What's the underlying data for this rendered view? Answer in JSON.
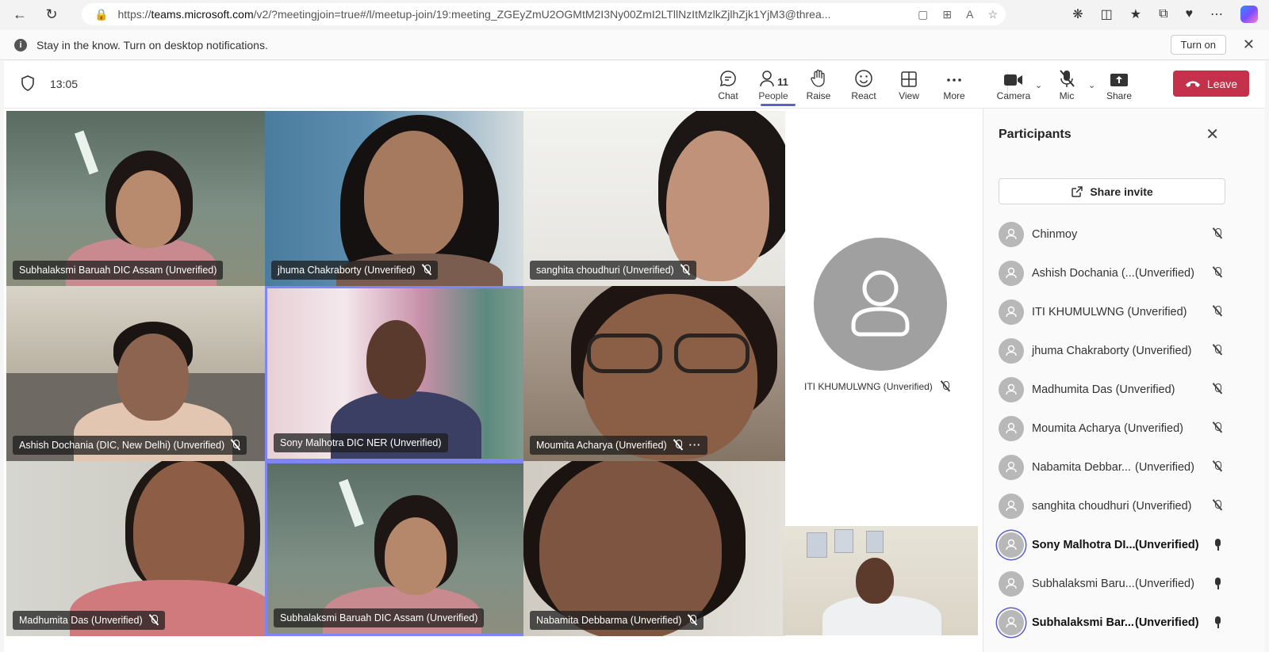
{
  "browser": {
    "url_prefix": "https://",
    "url_host": "teams.microsoft.com",
    "url_rest": "/v2/?meetingjoin=true#/l/meetup-join/19:meeting_ZGEyZmU2OGMtM2I3Ny00ZmI2LTllNzItMzlkZjlhZjk1YjM3@threa..."
  },
  "notification": {
    "text": "Stay in the know. Turn on desktop notifications.",
    "turn_on_label": "Turn on"
  },
  "meeting": {
    "time": "13:05",
    "tools": {
      "chat": "Chat",
      "people": "People",
      "people_count": "11",
      "raise": "Raise",
      "react": "React",
      "view": "View",
      "more": "More",
      "camera": "Camera",
      "mic": "Mic",
      "share": "Share",
      "leave": "Leave"
    }
  },
  "tiles": [
    {
      "name": "Subhalaksmi Baruah DIC Assam (Unverified)"
    },
    {
      "name": "jhuma Chakraborty (Unverified)"
    },
    {
      "name": "sanghita choudhuri (Unverified)"
    },
    {
      "name": "Ashish Dochania (DIC, New Delhi) (Unverified)"
    },
    {
      "name": "Sony Malhotra DIC NER (Unverified)"
    },
    {
      "name": "Moumita Acharya (Unverified)"
    },
    {
      "name": "Madhumita Das (Unverified)"
    },
    {
      "name": "Subhalaksmi Baruah DIC Assam (Unverified)"
    },
    {
      "name": "Nabamita Debbarma (Unverified)"
    }
  ],
  "featured": {
    "name": "ITI KHUMULWNG (Unverified)"
  },
  "panel": {
    "title": "Participants",
    "share_invite": "Share invite",
    "participants": [
      {
        "name": "Chinmoy",
        "status": ""
      },
      {
        "name": "Ashish Dochania (...",
        "status": "(Unverified)"
      },
      {
        "name": "ITI KHUMULWNG (Unverified)",
        "status": ""
      },
      {
        "name": "jhuma Chakraborty (Unverified)",
        "status": ""
      },
      {
        "name": "Madhumita Das (Unverified)",
        "status": ""
      },
      {
        "name": "Moumita Acharya (Unverified)",
        "status": ""
      },
      {
        "name": "Nabamita Debbar...",
        "status": "(Unverified)"
      },
      {
        "name": "sanghita choudhuri (Unverified)",
        "status": ""
      },
      {
        "name": "Sony Malhotra DI...",
        "status": "(Unverified)"
      },
      {
        "name": "Subhalaksmi Baru...",
        "status": "(Unverified)"
      },
      {
        "name": "Subhalaksmi Bar...",
        "status": "(Unverified)"
      }
    ]
  }
}
